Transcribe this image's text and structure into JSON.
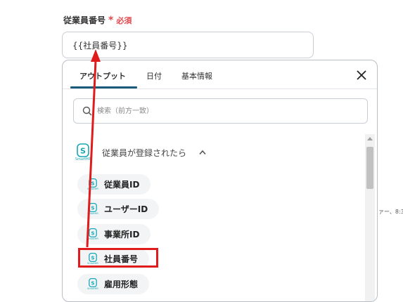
{
  "field": {
    "label": "従業員番号",
    "required_mark": "*",
    "required_text": "必須",
    "value": "{{社員番号}}"
  },
  "popup": {
    "tabs": [
      {
        "label": "アウトプット",
        "active": true
      },
      {
        "label": "日付",
        "active": false
      },
      {
        "label": "基本情報",
        "active": false
      }
    ],
    "search_placeholder": "検索（前方一致）",
    "group": {
      "label": "従業員が登録されたら",
      "logo_caption": "SmartHR",
      "expanded": true
    },
    "items": [
      {
        "label": "従業員ID",
        "logo_caption": "SmartHR"
      },
      {
        "label": "ユーザーID",
        "logo_caption": "SmartHR"
      },
      {
        "label": "事業所ID",
        "logo_caption": "SmartHR"
      },
      {
        "label": "社員番号",
        "logo_caption": "SmartHR",
        "highlighted": true
      },
      {
        "label": "雇用形態",
        "logo_caption": "SmartHR"
      }
    ]
  },
  "side_text": "ァー、8:3",
  "colors": {
    "accent_tab": "#1b5a79",
    "required": "#e5484d",
    "highlight": "#e01b1b",
    "smarthr": "#18a7b5"
  }
}
